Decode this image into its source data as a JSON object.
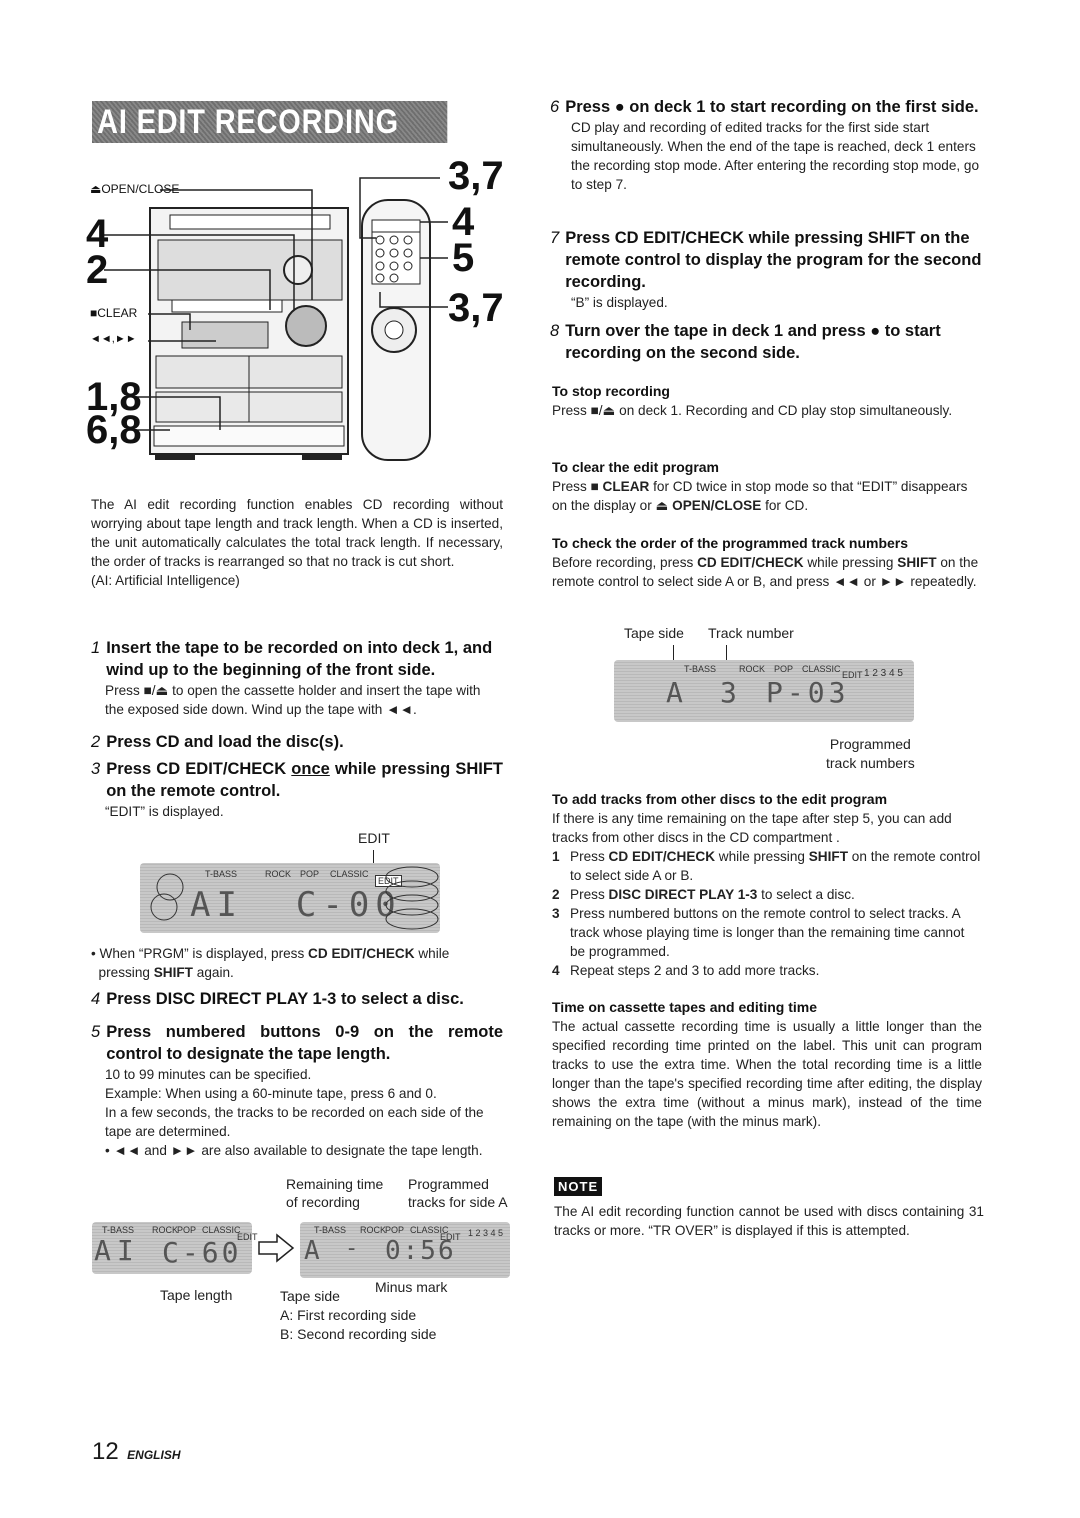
{
  "header": {
    "title": "AI EDIT RECORDING"
  },
  "illustration": {
    "labels": {
      "open_close": "⏏OPEN/CLOSE",
      "clear": "■CLEAR",
      "skip": "◄◄,►►",
      "callouts_left": [
        "4",
        "2",
        "1,8",
        "6,8"
      ],
      "callouts_right": [
        "3,7",
        "4",
        "5",
        "3,7"
      ]
    }
  },
  "intro": {
    "paragraph": "The AI edit recording function enables CD recording without worrying about tape length and track length.  When a CD is inserted, the unit automatically calculates the total track length. If necessary, the order of tracks is rearranged so that no track is cut short.",
    "footnote": "(AI: Artificial Intelligence)"
  },
  "steps": [
    {
      "num": "1",
      "title": "Insert the tape to be recorded on into deck 1, and wind up to the beginning of the front side.",
      "body": "Press ■/⏏ to open the cassette holder and insert the tape with the exposed side down. Wind up the tape with ◄◄."
    },
    {
      "num": "2",
      "title": "Press CD and load the disc(s)."
    },
    {
      "num": "3",
      "title_pre": "Press CD EDIT/CHECK ",
      "title_underline": "once",
      "title_post": " while pressing SHIFT on the remote control.",
      "body": "“EDIT” is displayed."
    },
    {
      "num": "4",
      "title": "Press DISC DIRECT PLAY 1-3 to select a disc."
    },
    {
      "num": "5",
      "title": "Press numbered buttons 0-9 on the remote control to designate the tape length.",
      "body_lines": [
        "10 to 99 minutes can be specified.",
        "Example: When using a 60-minute tape, press 6 and 0.",
        "In a few seconds, the tracks to be recorded on each side of the tape are determined.",
        "• ◄◄ and ►► are also available to designate the tape length."
      ]
    },
    {
      "num": "6",
      "title": "Press ● on deck 1 to start recording on the first side.",
      "body": "CD play and recording of edited tracks for the first side start simultaneously. When the end of the tape is reached, deck 1 enters the recording stop mode. After entering the recording stop mode, go to step 7."
    },
    {
      "num": "7",
      "title": "Press CD EDIT/CHECK while pressing SHIFT on the remote control to display the program for the second recording.",
      "body": "“B” is displayed."
    },
    {
      "num": "8",
      "title": "Turn over the tape in deck 1 and press ● to start recording on the second side."
    }
  ],
  "display_edit": {
    "callout": "EDIT",
    "indicators": [
      "T-BASS",
      "ROCK",
      "POP",
      "CLASSIC"
    ],
    "edit_badge": "EDIT",
    "segments": "AI  C-00",
    "note": "• When “PRGM” is displayed, press CD EDIT/CHECK while pressing SHIFT again."
  },
  "display_tape": {
    "left": {
      "indicators": [
        "T-BASS",
        "ROCK",
        "POP",
        "CLASSIC",
        "EDIT"
      ],
      "segments_ai": "AI",
      "segments": "C-60",
      "caption": "Tape length"
    },
    "right": {
      "indicators": [
        "T-BASS",
        "ROCK",
        "POP",
        "CLASSIC",
        "EDIT"
      ],
      "side": "A",
      "minus": "-",
      "time": "0:56",
      "tracks": "1 2 3 4 5"
    },
    "captions": {
      "remaining": "Remaining time\nof recording",
      "programmed": "Programmed\ntracks for side A",
      "minus_mark": "Minus mark",
      "tape_side": "Tape side",
      "side_a": "A: First recording side",
      "side_b": "B: Second recording side"
    }
  },
  "sections": {
    "stop": {
      "heading": "To stop recording",
      "body": "Press ■/⏏  on deck 1. Recording and CD play stop simultaneously."
    },
    "clear": {
      "heading": "To clear the edit program",
      "body_pre": "Press ■ ",
      "body_b1": "CLEAR",
      "body_mid": " for CD twice in stop mode so that “EDIT” disappears on the display or ⏏ ",
      "body_b2": "OPEN/CLOSE",
      "body_post": " for CD."
    },
    "check": {
      "heading": "To check the order of the programmed track numbers",
      "body_pre": "Before recording, press ",
      "body_b1": "CD EDIT/CHECK",
      "body_mid": " while pressing ",
      "body_b2": "SHIFT",
      "body_post": " on the remote control to select side A or B, and press ◄◄ or ►► repeatedly.",
      "display": {
        "label_side": "Tape side",
        "label_track": "Track number",
        "indicators": [
          "T-BASS",
          "ROCK",
          "POP",
          "CLASSIC",
          "EDIT"
        ],
        "side": "A",
        "track": "3",
        "program": "P-03",
        "tracks": "1 2 3 4 5",
        "caption": "Programmed\ntrack numbers"
      }
    },
    "add": {
      "heading": "To add tracks from other discs to the edit program",
      "intro": "If there is any time remaining on the tape after step 5, you can add tracks from other discs in the CD compartment .",
      "items": [
        {
          "n": "1",
          "pre": "Press ",
          "b1": "CD EDIT/CHECK",
          "mid": " while pressing ",
          "b2": "SHIFT",
          "post": " on the remote control to select side A or B."
        },
        {
          "n": "2",
          "pre": "Press ",
          "b1": "DISC DIRECT PLAY 1-3",
          "mid": " to select a disc.",
          "b2": "",
          "post": ""
        },
        {
          "n": "3",
          "pre": "Press numbered buttons on the remote control to select tracks. A track whose playing time is longer than the remaining time cannot be programmed.",
          "b1": "",
          "mid": "",
          "b2": "",
          "post": ""
        },
        {
          "n": "4",
          "pre": "Repeat steps 2 and 3 to add more tracks.",
          "b1": "",
          "mid": "",
          "b2": "",
          "post": ""
        }
      ]
    },
    "time": {
      "heading": "Time on cassette tapes and editing time",
      "body": "The actual cassette recording time is usually a little longer than the specified recording time printed on the label.  This unit can program tracks to use the extra time.  When the total recording time is a little longer than the tape's specified recording time after editing, the display shows the extra time (without a minus mark), instead of the time remaining on the tape (with the minus mark)."
    },
    "note": {
      "badge": "NOTE",
      "body": "The AI edit recording function cannot be used with discs containing 31 tracks or more. “TR OVER” is displayed if this is attempted."
    }
  },
  "footer": {
    "page": "12",
    "language": "ENGLISH"
  }
}
